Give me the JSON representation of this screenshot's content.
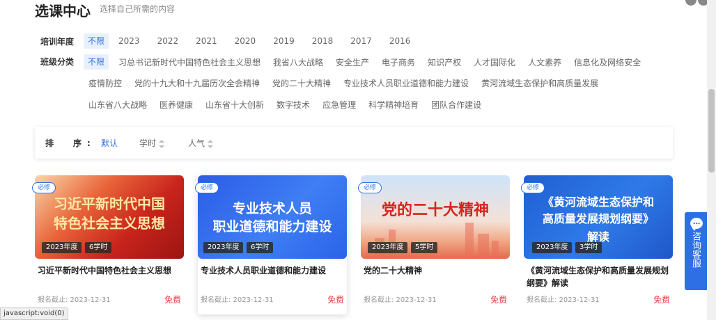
{
  "header": {
    "title": "选课中心",
    "subtitle": "选择自己所需的内容"
  },
  "filters": {
    "year": {
      "label": "培训年度",
      "options": [
        "不限",
        "2023",
        "2022",
        "2021",
        "2020",
        "2019",
        "2018",
        "2017",
        "2016"
      ],
      "selected": "不限"
    },
    "category": {
      "label": "班级分类",
      "options": [
        "不限",
        "习总书记新时代中国特色社会主义思想",
        "我省八大战略",
        "安全生产",
        "电子商务",
        "知识产权",
        "人才国际化",
        "人文素养",
        "信息化及网络安全",
        "疫情防控",
        "党的十九大和十九届历次全会精神",
        "党的二十大精神",
        "专业技术人员职业道德和能力建设",
        "黄河流域生态保护和高质量发展",
        "山东省八大战略",
        "医养健康",
        "山东省十大创新",
        "数字技术",
        "应急管理",
        "科学精神培育",
        "团队合作建设"
      ],
      "selected": "不限"
    }
  },
  "sort": {
    "label": "排　序:",
    "options": [
      "默认",
      "学时",
      "人气"
    ],
    "selected": "默认"
  },
  "courses": [
    {
      "badge": "必修",
      "cover_text": [
        "习近平新时代中国",
        "特色社会主义思想"
      ],
      "year_tag": "2023年度",
      "hours_tag": "6学时",
      "title": "习近平新时代中国特色社会主义思想",
      "deadline": "报名截止: 2023-12-31",
      "price": "免费",
      "cover_color": "#c8241c"
    },
    {
      "badge": "必修",
      "cover_text": [
        "专业技术人员",
        "职业道德和能力建设"
      ],
      "year_tag": "2023年度",
      "hours_tag": "6学时",
      "title": "专业技术人员职业道德和能力建设",
      "deadline": "报名截止: 2023-12-31",
      "price": "免费",
      "cover_color": "#3f7ef4"
    },
    {
      "badge": "必修",
      "cover_text": [
        "党的二十大精神"
      ],
      "year_tag": "2023年度",
      "hours_tag": "5学时",
      "title": "党的二十大精神",
      "deadline": "报名截止: 2023-12-31",
      "price": "免费",
      "cover_color": "#e46a4c"
    },
    {
      "badge": "必修",
      "cover_text": [
        "《黄河流域生态保护和",
        "高质量发展规划纲要》",
        "解读"
      ],
      "year_tag": "2023年度",
      "hours_tag": "3学时",
      "title": "《黄河流域生态保护和高质量发展规划纲要》解读",
      "deadline": "报名截止: 2023-12-31",
      "price": "免费",
      "cover_color": "#2f7ae8"
    }
  ],
  "side_service": {
    "label": "咨询客服",
    "icon": "chat-bubble-icon"
  },
  "status_bar": "javascript:void(0)",
  "colors": {
    "accent": "#2f6fe6",
    "price": "#e4393c",
    "active_bg": "#e8f0fd"
  }
}
